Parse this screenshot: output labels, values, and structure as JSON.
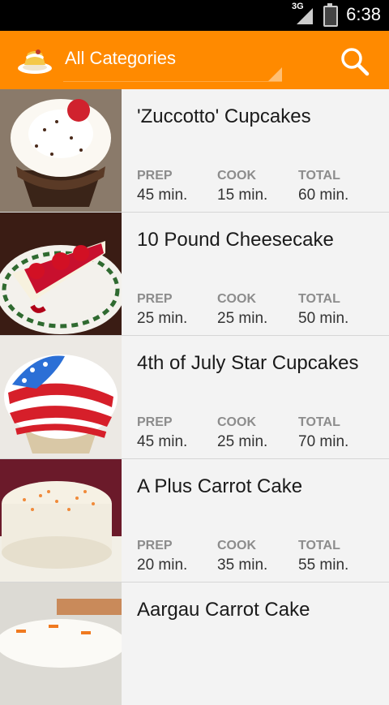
{
  "statusbar": {
    "network": "3G",
    "time": "6:38"
  },
  "header": {
    "title": "All Categories",
    "search_icon": "search-icon",
    "logo_icon": "cake-logo-icon"
  },
  "recipes": [
    {
      "name": "'Zuccotto' Cupcakes",
      "prep_label": "PREP",
      "prep": "45 min.",
      "cook_label": "COOK",
      "cook": "15 min.",
      "total_label": "TOTAL",
      "total": "60 min."
    },
    {
      "name": "10 Pound Cheesecake",
      "prep_label": "PREP",
      "prep": "25 min.",
      "cook_label": "COOK",
      "cook": "25 min.",
      "total_label": "TOTAL",
      "total": "50 min."
    },
    {
      "name": "4th of July Star Cupcakes",
      "prep_label": "PREP",
      "prep": "45 min.",
      "cook_label": "COOK",
      "cook": "25 min.",
      "total_label": "TOTAL",
      "total": "70 min."
    },
    {
      "name": "A Plus Carrot Cake",
      "prep_label": "PREP",
      "prep": "20 min.",
      "cook_label": "COOK",
      "cook": "35 min.",
      "total_label": "TOTAL",
      "total": "55 min."
    },
    {
      "name": "Aargau Carrot Cake"
    }
  ],
  "colors": {
    "accent": "#ff8a00",
    "statusbar": "#000000"
  }
}
